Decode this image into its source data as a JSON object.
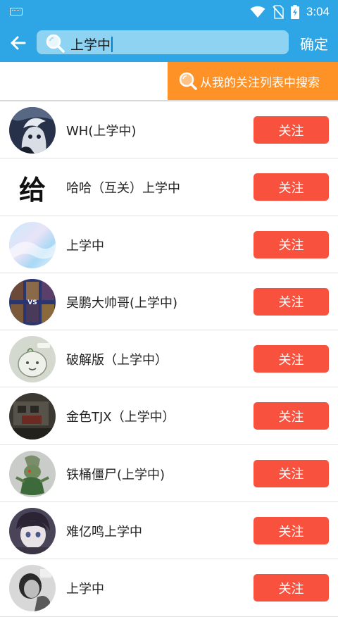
{
  "status_bar": {
    "time": "3:04"
  },
  "search": {
    "query": "上学中",
    "confirm_label": "确定"
  },
  "banner": {
    "label": "从我的关注列表中搜索"
  },
  "colors": {
    "primary": "#2ea6e6",
    "accent_orange": "#ff9226",
    "follow_red": "#f8523f"
  },
  "users": [
    {
      "name": "WH(上学中)",
      "avatar": "anime-boy-avatar",
      "follow_label": "关注"
    },
    {
      "name": "哈哈（互关）上学中",
      "avatar_text": "给",
      "follow_label": "关注"
    },
    {
      "name": "上学中",
      "avatar": "holographic-gradient-avatar",
      "follow_label": "关注"
    },
    {
      "name": "吴鹏大帅哥(上学中)",
      "avatar": "game-vs-avatar",
      "follow_label": "关注"
    },
    {
      "name": "破解版（上学中）",
      "avatar": "default-placeholder-avatar",
      "follow_label": "关注"
    },
    {
      "name": "金色TJX（上学中）",
      "avatar": "dark-figure-avatar",
      "follow_label": "关注"
    },
    {
      "name": "铁桶僵尸(上学中)",
      "avatar": "zombie-avatar",
      "follow_label": "关注"
    },
    {
      "name": "难亿鸣上学中",
      "avatar": "anime-girl-avatar",
      "follow_label": "关注"
    },
    {
      "name": "上学中",
      "avatar": "mono-photo-avatar",
      "follow_label": "关注"
    }
  ]
}
